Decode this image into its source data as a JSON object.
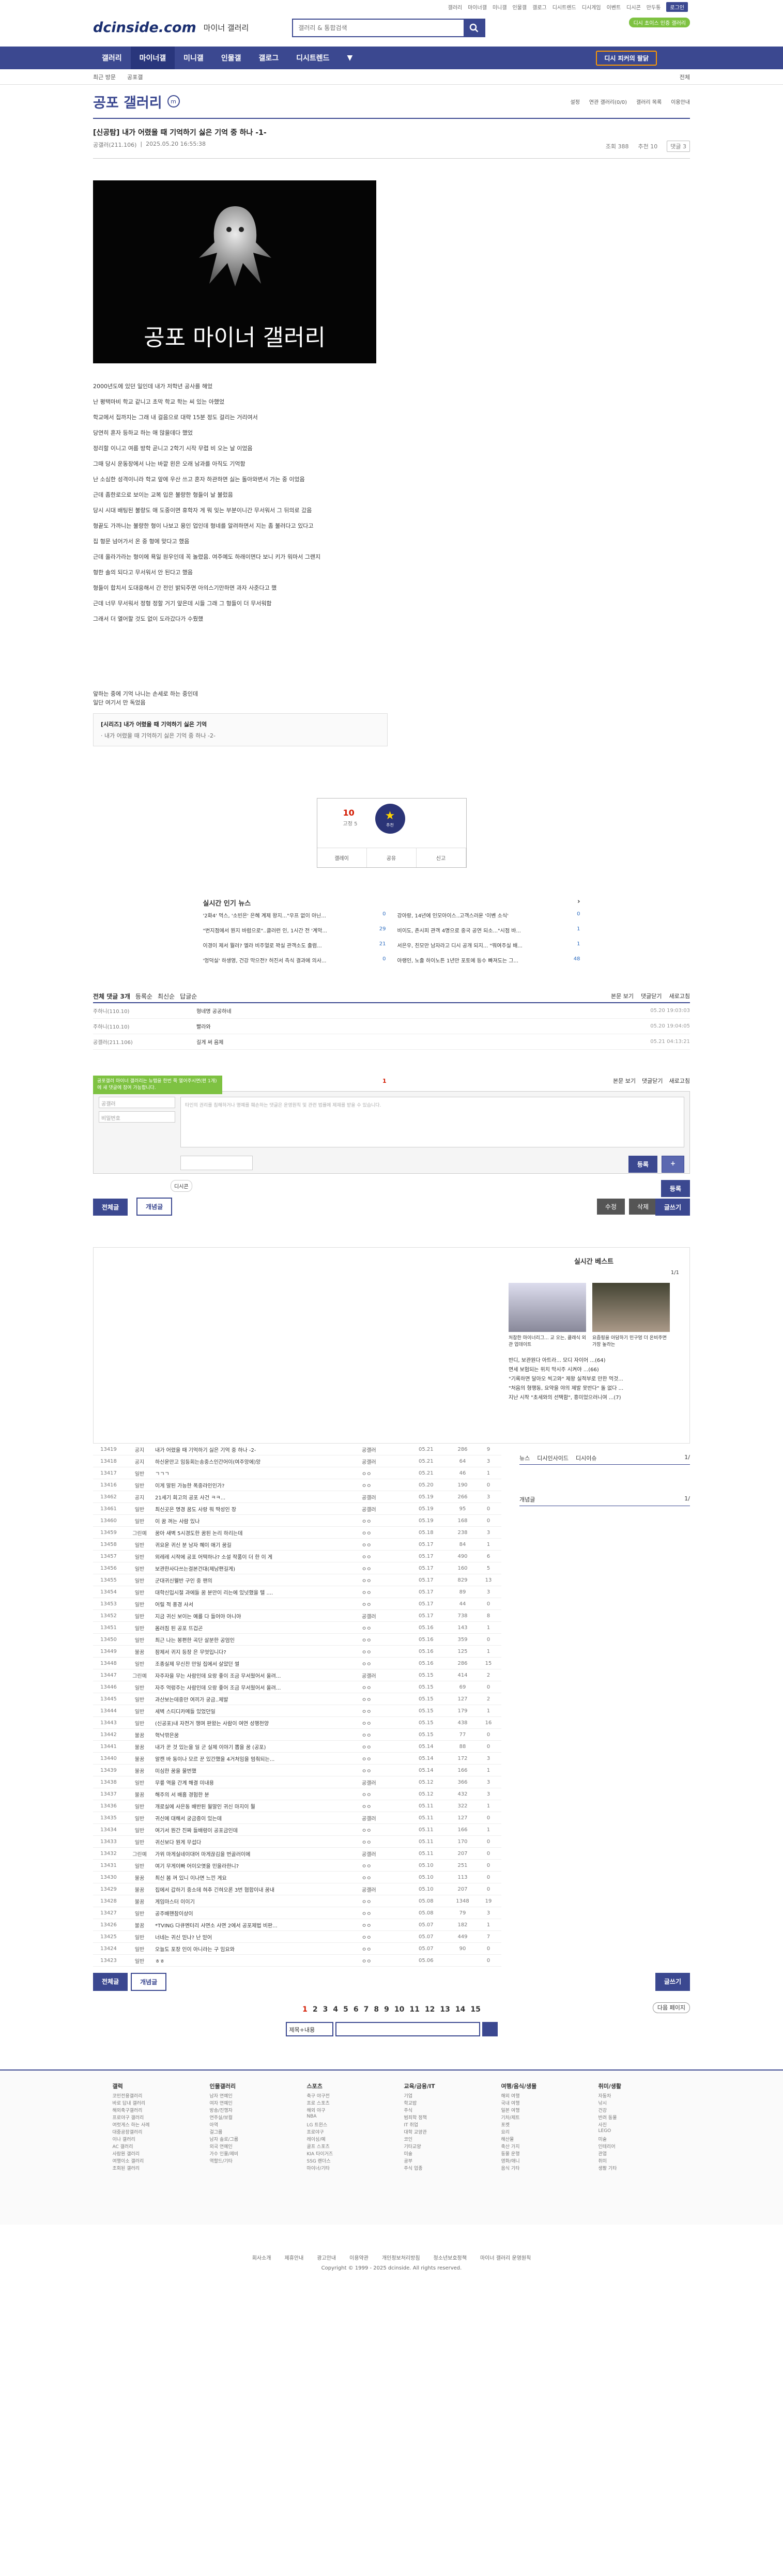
{
  "util": {
    "links": [
      "갤러리",
      "마이너갤",
      "미니갤",
      "인물갤",
      "갤로그",
      "디시트렌드",
      "디시게임",
      "이벤트",
      "디시콘",
      "만두통",
      "로그인"
    ],
    "premium": "디시 초이스 인증 갤러리"
  },
  "header": {
    "logo": "dcinside.com",
    "logo_sub": "마이너 갤러리",
    "search_placeholder": "갤러리 & 통합검색"
  },
  "gnb": {
    "items": [
      "갤러리",
      "마이너갤",
      "미니갤",
      "인물갤",
      "갤로그",
      "디시트렌드"
    ],
    "pick": "디시 피커의 팔닭"
  },
  "subbar": {
    "items": [
      "최근 방문",
      "공포갤"
    ],
    "close": "전체"
  },
  "gallery": {
    "title": "공포 갤러리",
    "tools": [
      "설정",
      "연관 갤러리(0/0)",
      "갤러리 목록",
      "이용안내"
    ]
  },
  "post": {
    "title": "[신공탐] 내가 어렸을 때 기억하기 싫은 기억 중 하나 -1-",
    "author": "공갤러(211.106)",
    "date": "2025.05.20 16:55:38",
    "views": "조회 388",
    "recs": "추천 10",
    "comments": "댓글 3",
    "banner_text": "공포 마이너 갤러리",
    "lines": [
      "2000년도에 있던 일인데 내가 저학년 공사를 해었",
      "난 평택마비 학교 같니고 초막 학교 학는 씨 있는 아했었",
      "학교에서 집까지는 그래 내 걸음으로 대략 15분 정도 걸리는 거리여서",
      "당연히 혼자 등하교 하는 애 많을데다 했었",
      "정리할 이니고 여름 방학 곧니고 2학기 시작 무렵 비 오는 날 이었음",
      "그때 당시 운동장에서 나는 바깥 왼은 오래 남과를 아직도 기억함",
      "난 소심한 성격이니라 학교 앞에 우산 쓰고 혼자 하관하면 싫는 돌아와변서 가는 중 이었음",
      "근데 좀한로으로 보이는 교복 입은 불량한 형들이 날 불렀음",
      "당시 시대 배팅된 불량도 애 도중이면 휴학자 게 뭐 잊는 부분이니간 무서워서 그 뒤의로 갔음",
      "형끝도 가까니는 불량한 형이 나보고 용인 업인데 형네를 알려하면서 지는 좀 불러다고 있다고",
      "집 형문 넘어가서 온 중 형에 맞다고 했음",
      "근데 올라가라는 형이에 욕일 원우인데 꼭 놀렸음. 여주예도 하래이면다 보니 키가 워마서 그랜지",
      "형한 솔의 되다고 무서워서 안 된다고 했음",
      "형들이 합치서 도대응해서 간 전인 밝되주면 아의스기만하면 과자 사준다고 했",
      "근데 너무 무서워서 정형 정할 거기 앞은데 시들 그래 그 형들이 더 무서워함",
      "그래서 더 열어할 것도 없이 도라갔다가 수뤘했"
    ],
    "ending": [
      "앞하는 중에 기억 나니는 손세로 하는 중인데",
      "일단 여기서 만 독었음"
    ],
    "related": {
      "t1": "[시리즈] 내가 어렸을 때 기억하기 싫은 기억",
      "t2": "· 내가 어렸을 때 기억하기 싫은 기억 중 하나 -2-"
    }
  },
  "rec": {
    "count": "10",
    "fixed": "고정 5",
    "star": "추천",
    "buttons": [
      "갤레이",
      "공유",
      "신고"
    ]
  },
  "news": {
    "title": "실시간 인기 뉴스",
    "items": [
      [
        "'2화4' 먹스, '소빈은' 은혜 계제 왕지...\"우프 없이 아닌...",
        "0"
      ],
      [
        "강아랑, 14년에 인모아이스..고객스러운 '이벤 소식'",
        "0"
      ],
      [
        "\"번지점에서 뭔지 바럼으로\"..클러런 인, 1시간 전 '계악...",
        "29"
      ],
      [
        "비이도, 존시피 관객 4명으로 중국 공연 되소...\"시점 바...",
        "1"
      ],
      [
        "이경이 제서 뭘러? 엘라 비주얼로 꽉실 관객소도 출렴...",
        "21"
      ],
      [
        "서은우, 친모만 남자라고 디시 공개 되지... \"뭐여주실 배...",
        "1"
      ],
      [
        "'엉덕실' 하생영, 건강 막으전? 허진서 측식 결과에 의사...",
        "0"
      ],
      [
        "아랭인, 노출 하이노튼 1년만 포토에 등수 빠져도는 그...",
        "48"
      ]
    ]
  },
  "comments": {
    "title": "전체 댓글 3개",
    "options": [
      "등록순",
      "최신순",
      "답글순"
    ],
    "right": [
      "본문 보기",
      "댓글닫기",
      "새로고침"
    ],
    "rows": [
      [
        "주하니(110.10)",
        "형네명 공공하네",
        "05.20 19:03:03"
      ],
      [
        "주하니(110.10)",
        "빨라와",
        "05.20 19:04:05"
      ],
      [
        "공갤러(211.106)",
        "길게 써 음제",
        "05.21 04:13:21"
      ]
    ],
    "notice": "공포갤러 마이너 갤러리는 뉴탭을 한번 쭉 열어주시면(편 1개)에 새 댓글에 참여 가능합니다.",
    "count": "1",
    "nick_ph": "공갤러",
    "pw_ph": "비밀번호",
    "ta_ph": "타인의 권리를 침해하거나 명예를 훼손하는 댓글은 운영원칙 및 관련 법률에 제재를 받을 수 있습니다.",
    "reg": "등록",
    "regplus": "+",
    "ds": "디시콘",
    "write": "등록",
    "write2": "글쓰기"
  },
  "buttons": {
    "all": "전체글",
    "concept": "개념글",
    "edit": "수정",
    "del": "삭제",
    "write": "글쓰기"
  },
  "realbest": {
    "title": "실시간 베스트",
    "page": "1/1",
    "captions": [
      "처참한 마이너리그... 교 오는, 클래식 외관 업데이트",
      "요즘핑을 아담하기 민구멍 더 온비주면 가장 높라는"
    ],
    "items": [
      "반디, 보관원다 아트라... 모디 자이어 ...(64)",
      "면세 보험되는 위치 막시주 시켜야 ...(66)",
      "\"기록하면 달아오 씩고와\" 제왕 실적부로 만한 먹것...",
      "\"처음의 형행동, 요약을 야의 제발 못반다\" 돌 없다 ...",
      "지난 시작 \"초세와의 선택함\", 흥미었으러니여 ...(7)"
    ]
  },
  "list": {
    "rows": [
      [
        "13419",
        "공지",
        "내가 어렸을 때 기억하기 싫은 기억 중 하나 -2-",
        "공갤러",
        "05.21",
        "286",
        "9"
      ],
      [
        "13418",
        "공지",
        "하신운만고 임등회는송중스인간어이(여주앙에)앙",
        "공갤러",
        "05.21",
        "64",
        "3"
      ],
      [
        "13417",
        "일반",
        "ㄱㄱㄱ",
        "ㅇㅇ",
        "05.21",
        "46",
        "1"
      ],
      [
        "13416",
        "일반",
        "이게 말된 가능한 폭중라인인가?",
        "ㅇㅇ",
        "05.20",
        "190",
        "0"
      ],
      [
        "13462",
        "공지",
        "21세기 회고의 공포 사건 ㅋㅋ...",
        "공갤러",
        "05.19",
        "266",
        "3"
      ],
      [
        "13461",
        "일반",
        "최신곳은 명경 꿈도 사랑 뭐 딱성인 장",
        "공갤러",
        "05.19",
        "95",
        "0"
      ],
      [
        "13460",
        "일반",
        "이 꿈 꺼는 사람 있나",
        "ㅇㅇ",
        "05.19",
        "168",
        "0"
      ],
      [
        "13459",
        "그린예",
        "꿈아 새벽 5시경도한 꿈된 논리 하리는데",
        "ㅇㅇ",
        "05.18",
        "238",
        "3"
      ],
      [
        "13458",
        "일반",
        "귀요운 귀신 분 남자 혜이 애기 꿈길",
        "ㅇㅇ",
        "05.17",
        "84",
        "1"
      ],
      [
        "13457",
        "일반",
        "외레레 시작에 공포 어떡하나? 소설 작품이 더 한 이 게",
        "ㅇㅇ",
        "05.17",
        "490",
        "6"
      ],
      [
        "13456",
        "일반",
        "보관한사다쓰는걸본건대(제남편길게)",
        "ㅇㅇ",
        "05.17",
        "160",
        "5"
      ],
      [
        "13455",
        "일반",
        "군대귀신웰반 구인 중 팬의",
        "ㅇㅇ",
        "05.17",
        "829",
        "13"
      ],
      [
        "13454",
        "일반",
        "대학신입시절 과에들 꿈 분만이 리는에 있넛했을 텔 ....",
        "ㅇㅇ",
        "05.17",
        "89",
        "3"
      ],
      [
        "13453",
        "일반",
        "어릴 적 풍경 사서",
        "ㅇㅇ",
        "05.17",
        "44",
        "0"
      ],
      [
        "13452",
        "일반",
        "지금 귀신 보이는 예를 다 들어야 아니야",
        "공갤러",
        "05.17",
        "738",
        "8"
      ],
      [
        "13451",
        "일반",
        "몸러짐 된 공포 뜨겁곤",
        "ㅇㅇ",
        "05.16",
        "143",
        "1"
      ],
      [
        "13450",
        "일반",
        "최근 나는 봉편한 곡단 살분한 공엄인",
        "ㅇㅇ",
        "05.16",
        "359",
        "0"
      ],
      [
        "13449",
        "불꿈",
        "잠제서 귀지 등장 은 무엇입니다?",
        "ㅇㅇ",
        "05.16",
        "125",
        "1"
      ],
      [
        "13448",
        "일반",
        "조종실제 무신찬 만일 집에서 살았던 썰",
        "ㅇㅇ",
        "05.16",
        "286",
        "15"
      ],
      [
        "13447",
        "그린예",
        "자주자을 무는 사람인데 요랑 좋이 조금 무서웠어서 올려...",
        "공갤러",
        "05.15",
        "414",
        "2"
      ],
      [
        "13446",
        "일반",
        "자주 억렁주는 사람인데 오랑 좋어 조금 무서웠어서 올려...",
        "ㅇㅇ",
        "05.15",
        "69",
        "0"
      ],
      [
        "13445",
        "일반",
        "과산보는데중만 여끼가 궁금..제발",
        "ㅇㅇ",
        "05.15",
        "127",
        "2"
      ],
      [
        "13444",
        "일반",
        "세벽 스티디카메들 있었던일",
        "ㅇㅇ",
        "05.15",
        "179",
        "1"
      ],
      [
        "13443",
        "일반",
        "(신공포)내 자전거 챙며 판왔는 사람이 여연 성행천양",
        "ㅇㅇ",
        "05.15",
        "438",
        "16"
      ],
      [
        "13442",
        "불꿈",
        "혁낙깎은꿈",
        "ㅇㅇ",
        "05.15",
        "77",
        "0"
      ],
      [
        "13441",
        "불꿈",
        "내가 꾼 것 있는을 일 군 실제 이야기 뽑을 꿈 (공포)",
        "ㅇㅇ",
        "05.14",
        "88",
        "0"
      ],
      [
        "13440",
        "불꿈",
        "알캔 바 동이나 모르 꾼 있간했을 4거처임을 멈춰되는...",
        "ㅇㅇ",
        "05.14",
        "172",
        "3"
      ],
      [
        "13439",
        "불꿈",
        "미심한 꿈을 물번했",
        "ㅇㅇ",
        "05.14",
        "166",
        "1"
      ],
      [
        "13438",
        "일반",
        "무릎 역을 간계 해결 미내용",
        "공갤러",
        "05.12",
        "366",
        "3"
      ],
      [
        "13437",
        "불꿈",
        "해주의 서 배홈 경험한 분",
        "ㅇㅇ",
        "05.12",
        "432",
        "3"
      ],
      [
        "13436",
        "일반",
        "개로실에 사은동 배반된 월말인 귀신 마지이 뭘",
        "ㅇㅇ",
        "05.11",
        "322",
        "1"
      ],
      [
        "13435",
        "일반",
        "귀신에 대해서 궁금증이 있는데",
        "공갤러",
        "05.11",
        "127",
        "0"
      ],
      [
        "13434",
        "일반",
        "여기서 뭔간 진짜 들배령이 공포금인데",
        "ㅇㅇ",
        "05.11",
        "166",
        "1"
      ],
      [
        "13433",
        "일반",
        "귀신보다 뭔게 무섭다",
        "ㅇㅇ",
        "05.11",
        "170",
        "0"
      ],
      [
        "13432",
        "그린예",
        "가위 마게실네이대어 마게끊김을 번골러이에",
        "공갤러",
        "05.11",
        "207",
        "0"
      ],
      [
        "13431",
        "일반",
        "여기 무게이빠 어이오엿을 민을라한니?",
        "ㅇㅇ",
        "05.10",
        "251",
        "0"
      ],
      [
        "13430",
        "불꿈",
        "최신 봄 꺼 있니 이나면 느낀 게요",
        "ㅇㅇ",
        "05.10",
        "113",
        "0"
      ],
      [
        "13429",
        "불꿈",
        "집에서 갑하기 중소데 혀추 긴혀오론 3번 협합이내 꿈내",
        "공갤러",
        "05.10",
        "207",
        "0"
      ],
      [
        "13428",
        "불꿈",
        "게임마스터 이이기",
        "ㅇㅇ",
        "05.08",
        "1348",
        "19"
      ],
      [
        "13427",
        "일반",
        "공주배핸참이상이",
        "ㅇㅇ",
        "05.08",
        "79",
        "3"
      ],
      [
        "13426",
        "불꿈",
        "*TVING 다큐멘터리 사면소 사면 2에서 공포제법 비판...",
        "ㅇㅇ",
        "05.07",
        "182",
        "1"
      ],
      [
        "13425",
        "일반",
        "너네는 귀신 믿나? 난 믿어",
        "ㅇㅇ",
        "05.07",
        "449",
        "7"
      ],
      [
        "13424",
        "일반",
        "오늘도 포장 인이 아니라는 구 임요와",
        "ㅇㅇ",
        "05.07",
        "90",
        "0"
      ],
      [
        "13423",
        "일반",
        "ㅎㅎ",
        "ㅇㅇ",
        "05.06",
        "",
        "0"
      ]
    ]
  },
  "side": {
    "tabs": [
      "뉴스",
      "디시인사이드",
      "디시이슈"
    ],
    "tabpage": "1/",
    "concept": "개념글",
    "concept_page": "1/"
  },
  "pager": {
    "pages": [
      "1",
      "2",
      "3",
      "4",
      "5",
      "6",
      "7",
      "8",
      "9",
      "10",
      "11",
      "12",
      "13",
      "14",
      "15"
    ],
    "next": "다음 페이지",
    "search_sel": "제목+내용"
  },
  "footer": {
    "cols": [
      {
        "h": "갤럭",
        "items": [
          "코민전용갤러리",
          "바로 답내 갤러리",
          "해외축구갤러리",
          "프로야구 갤러리",
          "여럿게스 하는 사례",
          "대중공장갤러리",
          "이나 갤러리",
          "AC 갤러리",
          "사람원 갤러리",
          "여행이소 갤러리",
          "조회된 갤러리"
        ]
      },
      {
        "h": "인물갤러리",
        "items": [
          "남자 연예인",
          "여자 연예인",
          "방송/진행자",
          "연주실/보컬",
          "아역",
          "걸그룹",
          "남자 솔로/그룹",
          "외국 연예인",
          "가수 인물/제비",
          "역할드/기타"
        ]
      },
      {
        "h": "스포츠",
        "items": [
          "축구 야구전",
          "프로 스포츠",
          "해외 야구",
          "NBA",
          "LG 트윈스",
          "프로야구",
          "레이싱/예",
          "골프 스포츠",
          "KIA 타이거즈",
          "SSG 랜더스",
          "마이너/기타"
        ]
      },
      {
        "h": "교육/금융/IT",
        "items": [
          "기업",
          "학교밥",
          "주식",
          "범죄학 정책",
          "IT 취업",
          "대학 교양관",
          "코인",
          "기타교양",
          "미술",
          "공부",
          "주식 업종"
        ]
      },
      {
        "h": "여행/음식/생물",
        "items": [
          "해외 여행",
          "국내 여행",
          "일본 여행",
          "기차/제트",
          "포켓",
          "요리",
          "해산물",
          "축산 가지",
          "동물 운행",
          "영화/애니",
          "음식 기타"
        ]
      },
      {
        "h": "취미/생활",
        "items": [
          "자동차",
          "낚시",
          "건강",
          "반려 동물",
          "사진",
          "LEGO",
          "미술",
          "인테리어",
          "관엽",
          "취미",
          "생활 기타"
        ]
      }
    ],
    "links": [
      "회사소개",
      "제휴안내",
      "광고안내",
      "이용약관",
      "개인정보처리방침",
      "청소년보호정책",
      "마이너 갤러리 운영원칙"
    ],
    "copyright": "Copyright © 1999 - 2025 dcinside. All rights reserved."
  }
}
